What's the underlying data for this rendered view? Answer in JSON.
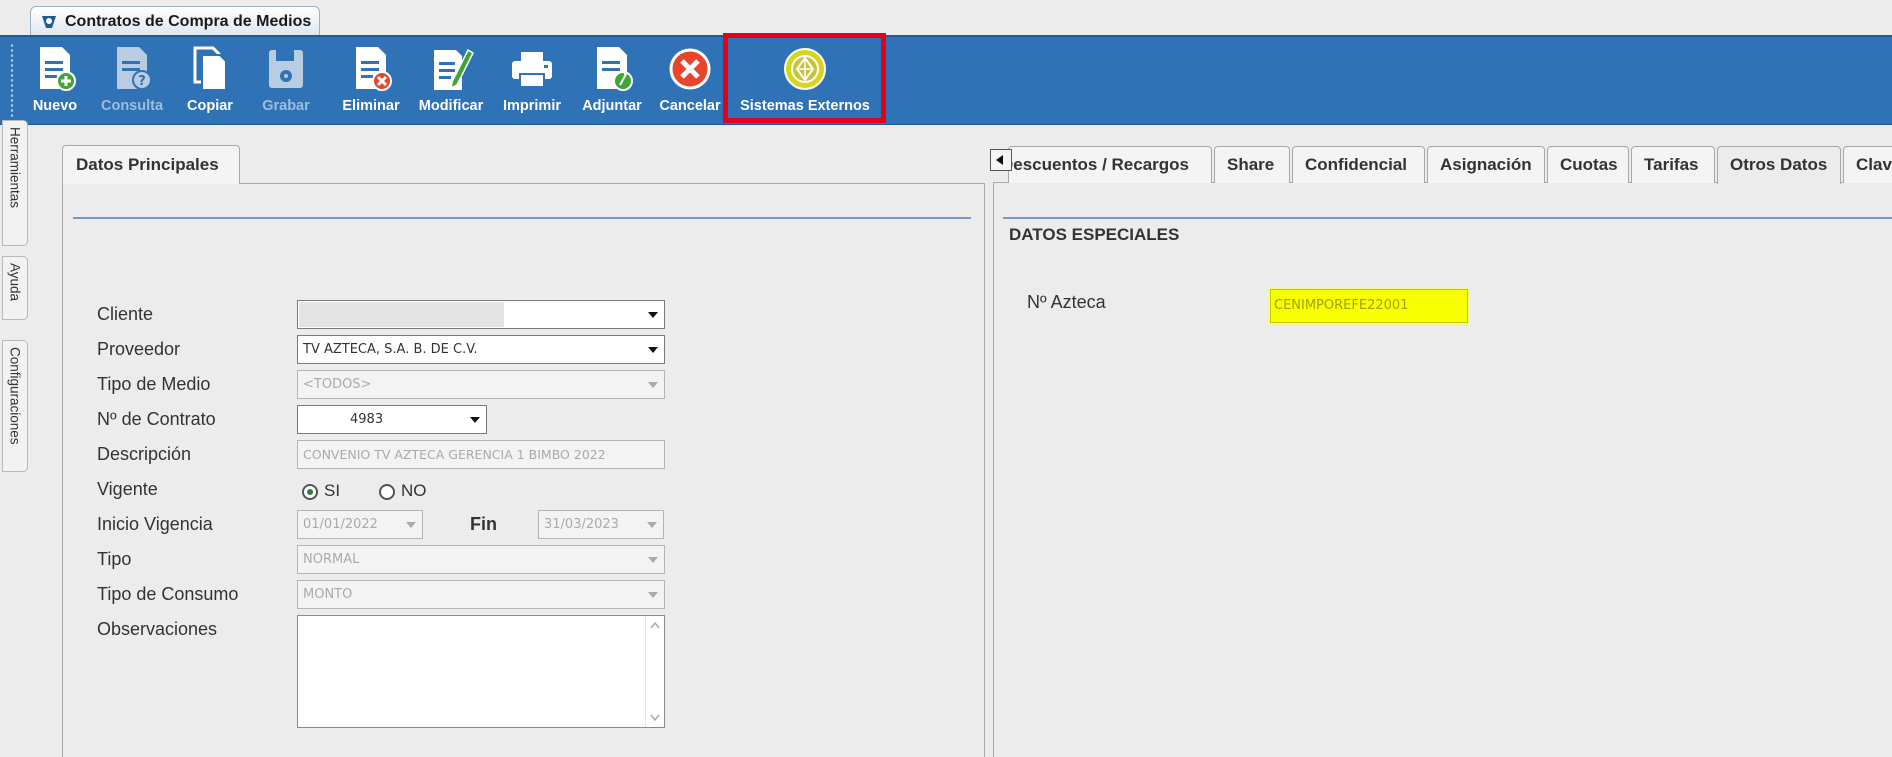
{
  "window_tab": {
    "title": "Contratos de Compra de Medios"
  },
  "toolbar": {
    "buttons": [
      {
        "label": "Nuevo",
        "icon": "document-add-icon",
        "enabled": true
      },
      {
        "label": "Consulta",
        "icon": "document-query-icon",
        "enabled": false
      },
      {
        "label": "Copiar",
        "icon": "copy-icon",
        "enabled": true
      },
      {
        "label": "Grabar",
        "icon": "save-disk-icon",
        "enabled": false
      },
      {
        "label": "Eliminar",
        "icon": "document-delete-icon",
        "enabled": true
      },
      {
        "label": "Modificar",
        "icon": "document-edit-icon",
        "enabled": true
      },
      {
        "label": "Imprimir",
        "icon": "printer-icon",
        "enabled": true
      },
      {
        "label": "Adjuntar",
        "icon": "attachment-icon",
        "enabled": true
      },
      {
        "label": "Cancelar",
        "icon": "cancel-icon",
        "enabled": true
      },
      {
        "label": "Sistemas Externos",
        "icon": "external-systems-icon",
        "enabled": true,
        "highlighted": true
      }
    ]
  },
  "side_tabs": [
    "Herramientas",
    "Ayuda",
    "Configuraciones"
  ],
  "left_panel": {
    "tab": "Datos Principales",
    "fields": {
      "cliente": {
        "label": "Cliente",
        "value": ""
      },
      "proveedor": {
        "label": "Proveedor",
        "value": "TV AZTECA, S.A. B. DE C.V."
      },
      "tipo_medio": {
        "label": "Tipo de Medio",
        "value": "<TODOS>"
      },
      "contrato": {
        "label": "Nº de Contrato",
        "value": "4983"
      },
      "descripcion": {
        "label": "Descripción",
        "value": "CONVENIO TV AZTECA GERENCIA 1 BIMBO 2022"
      },
      "vigente": {
        "label": "Vigente",
        "options": [
          "SI",
          "NO"
        ],
        "selected": "SI"
      },
      "inicio": {
        "label": "Inicio Vigencia",
        "value": "01/01/2022"
      },
      "fin": {
        "label": "Fin",
        "value": "31/03/2023"
      },
      "tipo": {
        "label": "Tipo",
        "value": "NORMAL"
      },
      "tipo_consumo": {
        "label": "Tipo de Consumo",
        "value": "MONTO"
      },
      "observaciones": {
        "label": "Observaciones",
        "value": ""
      }
    }
  },
  "right_panel": {
    "tabs": [
      "Descuentos / Recargos",
      "Share",
      "Confidencial",
      "Asignación",
      "Cuotas",
      "Tarifas",
      "Otros Datos",
      "Clave"
    ],
    "active_tab": "Otros Datos",
    "section_title": "DATOS ESPECIALES",
    "azteca": {
      "label": "Nº Azteca",
      "value": "CENIMPOREFE22001"
    }
  },
  "colors": {
    "toolbar": "#2f72b5",
    "highlight": "#e3001b",
    "field_highlight": "#f8ff00"
  }
}
